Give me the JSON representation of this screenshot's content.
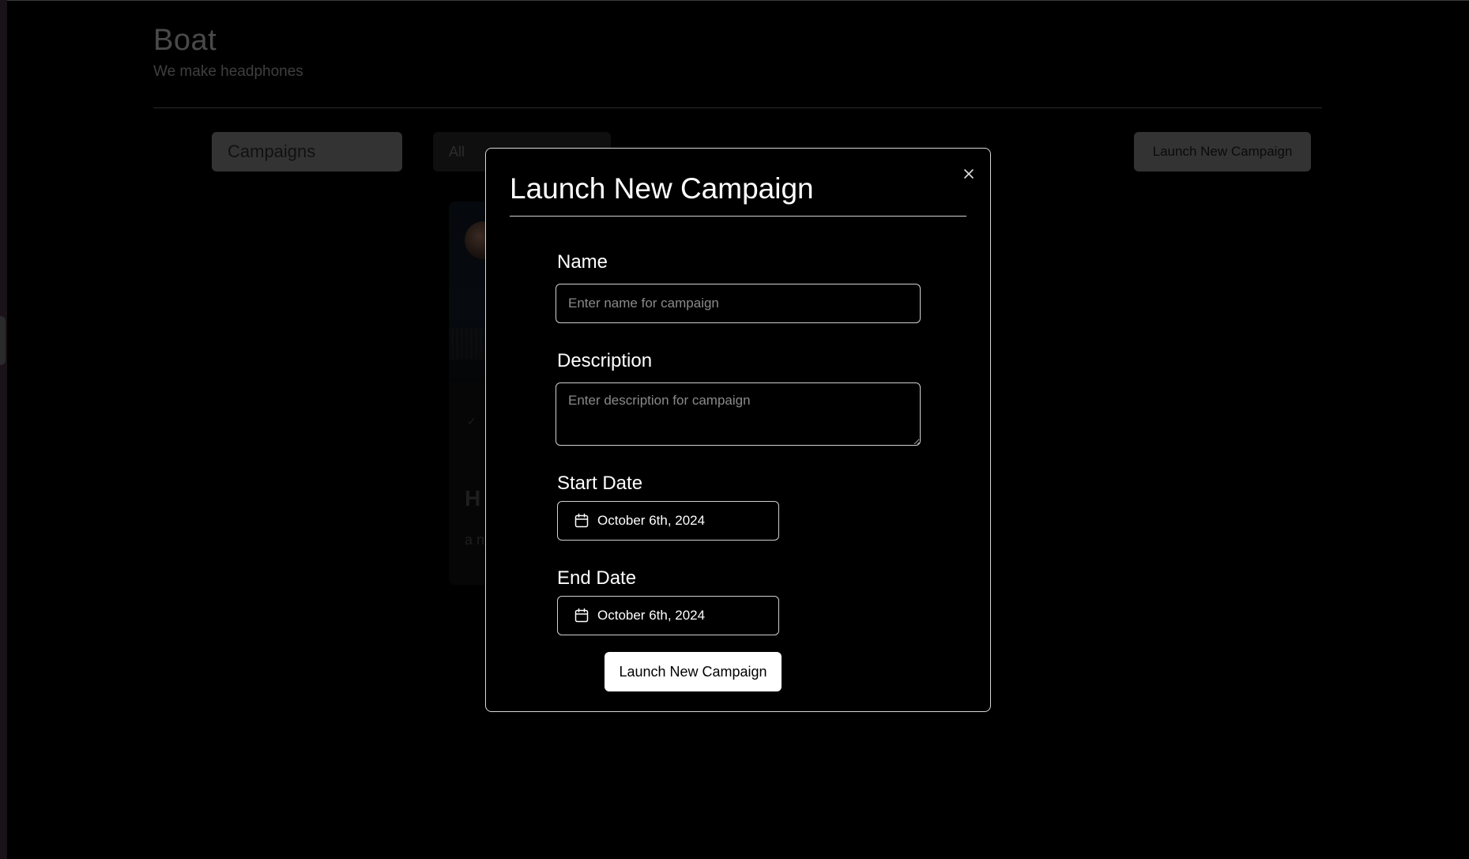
{
  "brand": {
    "title": "Boat",
    "subtitle": "We make headphones"
  },
  "toolbar": {
    "campaigns_tab_label": "Campaigns",
    "filter_selected": "All",
    "launch_button_label": "Launch New Campaign"
  },
  "card": {
    "title_fragment": "H",
    "description_fragment": "a n"
  },
  "modal": {
    "title": "Launch New Campaign",
    "name_label": "Name",
    "name_value": "",
    "name_placeholder": "Enter name for campaign",
    "description_label": "Description",
    "description_value": "",
    "description_placeholder": "Enter description for campaign",
    "start_date_label": "Start Date",
    "start_date_value": "October 6th, 2024",
    "end_date_label": "End Date",
    "end_date_value": "October 6th, 2024",
    "submit_label": "Launch New Campaign"
  },
  "icons": {
    "close": "close-icon",
    "calendar": "calendar-icon",
    "check": "check-icon"
  },
  "colors": {
    "background": "#000000",
    "modal_border": "#d8d8d8",
    "submit_background": "#ffffff",
    "dimmed_button": "#333333"
  }
}
